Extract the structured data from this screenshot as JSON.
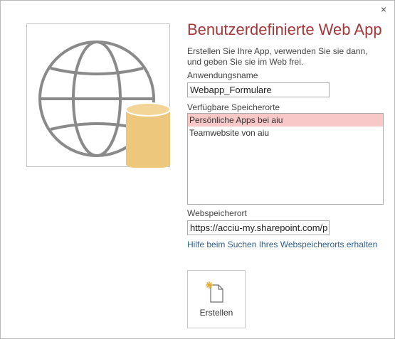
{
  "dialog": {
    "close_glyph": "×",
    "title": "Benutzerdefinierte Web App",
    "description": "Erstellen Sie Ihre App, verwenden Sie sie dann, und geben Sie sie im Web frei."
  },
  "app_name": {
    "label": "Anwendungsname",
    "value": "Webapp_Formulare"
  },
  "locations": {
    "label": "Verfügbare Speicherorte",
    "items": [
      {
        "label": "Persönliche Apps bei aiu",
        "selected": true
      },
      {
        "label": "Teamwebsite von aiu",
        "selected": false
      }
    ]
  },
  "web_location": {
    "label": "Webspeicherort",
    "value": "https://acciu-my.sharepoint.com/p",
    "help_link": "Hilfe beim Suchen Ihres Webspeicherorts erhalten"
  },
  "create_button": {
    "label": "Erstellen",
    "icon": "new-document-icon"
  },
  "preview": {
    "icon": "globe-database-icon"
  },
  "colors": {
    "title": "#a4373a",
    "selection": "#f8c8c8",
    "link": "#2e6196",
    "database": "#edc77b"
  }
}
